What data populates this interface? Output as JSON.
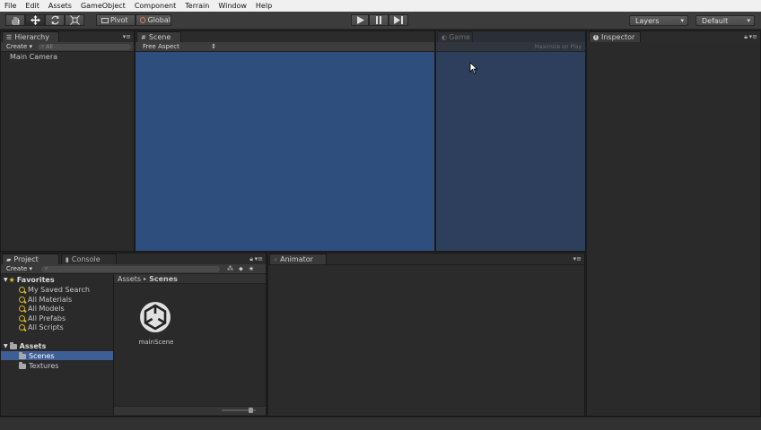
{
  "menu": [
    "File",
    "Edit",
    "Assets",
    "GameObject",
    "Component",
    "Terrain",
    "Window",
    "Help"
  ],
  "toolbar": {
    "pivot": "Pivot",
    "global": "Global",
    "layers": "Layers",
    "layout": "Default"
  },
  "hierarchy": {
    "tab": "Hierarchy",
    "create": "Create",
    "search_placeholder": "All",
    "items": [
      "Main Camera"
    ]
  },
  "scene": {
    "tab": "Scene",
    "aspect": "Free Aspect",
    "bg_color": "#2e4e7e"
  },
  "game": {
    "tab": "Game",
    "maximize": "Maximize on Play",
    "bg_color": "#2e3f5e"
  },
  "inspector": {
    "tab": "Inspector"
  },
  "project": {
    "tab": "Project",
    "create": "Create",
    "favorites_label": "Favorites",
    "favorites": [
      "My Saved Search",
      "All Materials",
      "All Models",
      "All Prefabs",
      "All Scripts"
    ],
    "assets_label": "Assets",
    "folders": [
      "Scenes",
      "Textures"
    ],
    "breadcrumb": [
      "Assets",
      "Scenes"
    ],
    "file_name": "mainScene"
  },
  "console": {
    "tab": "Console"
  },
  "animator": {
    "tab": "Animator"
  }
}
